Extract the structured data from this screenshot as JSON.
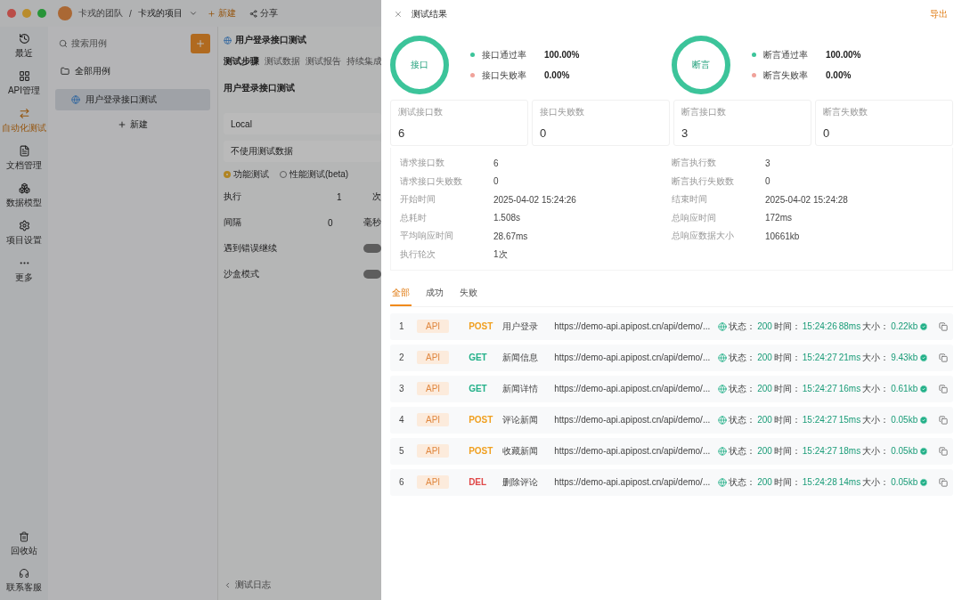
{
  "app": {
    "breadcrumb": [
      "卡戎的团队",
      "卡戎的项目"
    ],
    "breadcrumb_separator": "/",
    "header_actions": [
      {
        "kind": "new",
        "label": "新建"
      },
      {
        "kind": "share",
        "label": "分享"
      }
    ],
    "sidebar": [
      {
        "label": "最近",
        "selected": false
      },
      {
        "label": "API管理",
        "selected": false
      },
      {
        "label": "自动化测试",
        "selected": true
      },
      {
        "label": "文档管理",
        "selected": false
      },
      {
        "label": "数据模型",
        "selected": false
      },
      {
        "label": "项目设置",
        "selected": false
      },
      {
        "label": "更多",
        "selected": false
      }
    ],
    "sidebar_bottom": [
      {
        "label": "回收站"
      },
      {
        "label": "联系客服"
      }
    ],
    "search": {
      "placeholder": "搜索用例"
    },
    "tree": {
      "label": "全部用例",
      "children": [
        {
          "label": "用户登录接口测试",
          "selected": true
        }
      ]
    },
    "new_button": "新建",
    "editor": {
      "tab": "用户登录接口测试",
      "subtabs": [
        {
          "label": "测试步骤",
          "selected": true
        },
        {
          "label": "测试数据",
          "selected": false
        },
        {
          "label": "测试报告",
          "selected": false
        },
        {
          "label": "持续集成",
          "selected": false
        }
      ],
      "title": "用户登录接口测试",
      "environment": "Local",
      "data_option": "不使用测试数据",
      "modes": [
        {
          "label": "功能测试",
          "selected": true
        },
        {
          "label": "性能测试(beta)",
          "selected": false
        }
      ],
      "fields": [
        {
          "label": "执行",
          "value": "1",
          "unit": "次"
        },
        {
          "label": "间隔",
          "value": "0",
          "unit": "毫秒"
        }
      ],
      "switches": [
        {
          "label": "遇到错误继续",
          "on": false
        },
        {
          "label": "沙盒模式",
          "on": false
        }
      ],
      "footer": "测试日志"
    }
  },
  "drawer": {
    "title": "测试结果",
    "export": "导出",
    "rings": [
      {
        "label": "接口",
        "rates": [
          {
            "label": "接口通过率",
            "value": "100.00%",
            "color": "#3cc49a"
          },
          {
            "label": "接口失败率",
            "value": "0.00%",
            "color": "#f0a29a"
          }
        ]
      },
      {
        "label": "断言",
        "rates": [
          {
            "label": "断言通过率",
            "value": "100.00%",
            "color": "#3cc49a"
          },
          {
            "label": "断言失败率",
            "value": "0.00%",
            "color": "#f0a29a"
          }
        ]
      }
    ],
    "cards": [
      {
        "label": "测试接口数",
        "value": "6"
      },
      {
        "label": "接口失败数",
        "value": "0"
      },
      {
        "label": "断言接口数",
        "value": "3"
      },
      {
        "label": "断言失败数",
        "value": "0"
      }
    ],
    "details_left": [
      {
        "label": "请求接口数",
        "value": "6"
      },
      {
        "label": "请求接口失败数",
        "value": "0"
      },
      {
        "label": "开始时间",
        "value": "2025-04-02 15:24:26"
      },
      {
        "label": "总耗时",
        "value": "1.508s"
      },
      {
        "label": "平均响应时间",
        "value": "28.67ms"
      },
      {
        "label": "执行轮次",
        "value": "1次"
      }
    ],
    "details_right": [
      {
        "label": "断言执行数",
        "value": "3"
      },
      {
        "label": "断言执行失败数",
        "value": "0"
      },
      {
        "label": "结束时间",
        "value": "2025-04-02 15:24:28"
      },
      {
        "label": "总响应时间",
        "value": "172ms"
      },
      {
        "label": "总响应数据大小",
        "value": "10661kb"
      }
    ],
    "filters": [
      {
        "label": "全部",
        "selected": true
      },
      {
        "label": "成功",
        "selected": false
      },
      {
        "label": "失败",
        "selected": false
      }
    ],
    "results": [
      {
        "index": "1",
        "tag": "API",
        "method": {
          "label": "POST",
          "color": "#f0a020"
        },
        "name": "用户登录",
        "url": "https://demo-api.apipost.cn/api/demo/...",
        "status_label": "状态：",
        "status": "200",
        "time_label": "时间：",
        "time": "15:24:26",
        "duration": "88ms",
        "size_label": "大小：",
        "size": "0.22kb"
      },
      {
        "index": "2",
        "tag": "API",
        "method": {
          "label": "GET",
          "color": "#22b088"
        },
        "name": "新闻信息",
        "url": "https://demo-api.apipost.cn/api/demo/...",
        "status_label": "状态：",
        "status": "200",
        "time_label": "时间：",
        "time": "15:24:27",
        "duration": "21ms",
        "size_label": "大小：",
        "size": "9.43kb"
      },
      {
        "index": "3",
        "tag": "API",
        "method": {
          "label": "GET",
          "color": "#22b088"
        },
        "name": "新闻详情",
        "url": "https://demo-api.apipost.cn/api/demo/...",
        "status_label": "状态：",
        "status": "200",
        "time_label": "时间：",
        "time": "15:24:27",
        "duration": "16ms",
        "size_label": "大小：",
        "size": "0.61kb"
      },
      {
        "index": "4",
        "tag": "API",
        "method": {
          "label": "POST",
          "color": "#f0a020"
        },
        "name": "评论新闻",
        "url": "https://demo-api.apipost.cn/api/demo/...",
        "status_label": "状态：",
        "status": "200",
        "time_label": "时间：",
        "time": "15:24:27",
        "duration": "15ms",
        "size_label": "大小：",
        "size": "0.05kb"
      },
      {
        "index": "5",
        "tag": "API",
        "method": {
          "label": "POST",
          "color": "#f0a020"
        },
        "name": "收藏新闻",
        "url": "https://demo-api.apipost.cn/api/demo/...",
        "status_label": "状态：",
        "status": "200",
        "time_label": "时间：",
        "time": "15:24:27",
        "duration": "18ms",
        "size_label": "大小：",
        "size": "0.05kb"
      },
      {
        "index": "6",
        "tag": "API",
        "method": {
          "label": "DEL",
          "color": "#e04848"
        },
        "name": "删除评论",
        "url": "https://demo-api.apipost.cn/api/demo/...",
        "status_label": "状态：",
        "status": "200",
        "time_label": "时间：",
        "time": "15:24:28",
        "duration": "14ms",
        "size_label": "大小：",
        "size": "0.05kb"
      }
    ]
  }
}
